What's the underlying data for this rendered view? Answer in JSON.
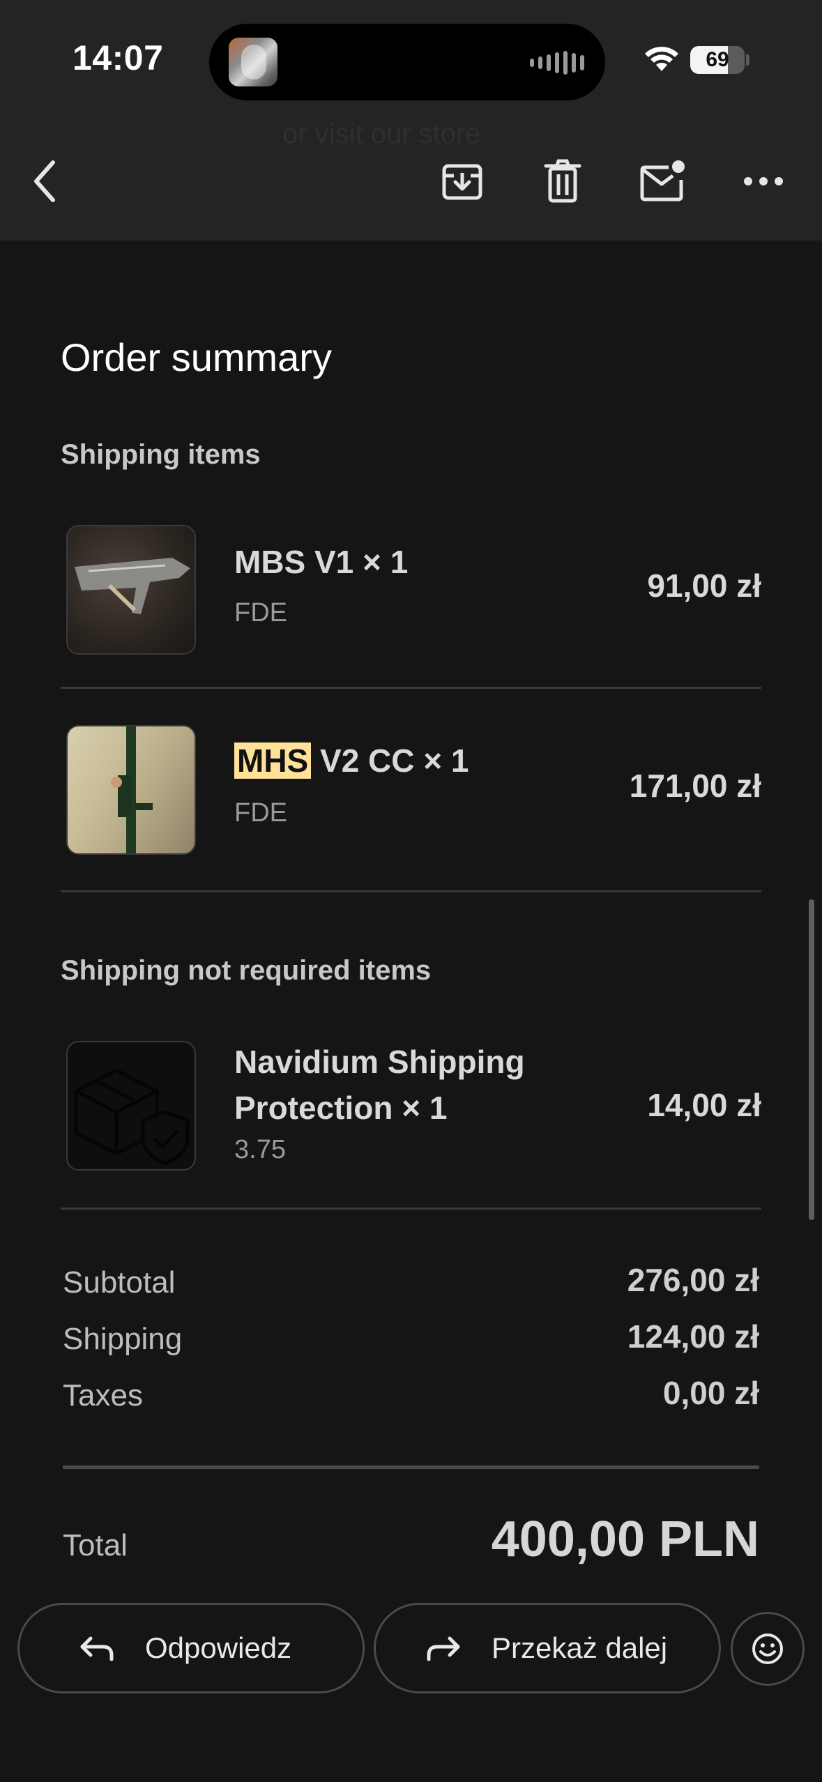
{
  "status_bar": {
    "time": "14:07",
    "battery": "69",
    "battery_level": 0.69,
    "icons": [
      "album-art-icon",
      "waveform-icon",
      "wifi-icon",
      "battery-icon"
    ]
  },
  "header": {
    "ghost_text": "or visit our store",
    "buttons": [
      "back-chevron-icon",
      "archive-icon",
      "trash-icon",
      "mark-unread-icon",
      "more-icon"
    ]
  },
  "order": {
    "title": "Order summary",
    "shipping_section": "Shipping items",
    "items": [
      {
        "name": "MBS V1 × 1",
        "name_highlight": "",
        "variant": "FDE",
        "price": "91,00 zł"
      },
      {
        "name": " V2 CC × 1",
        "name_highlight": "MHS",
        "variant": "FDE",
        "price": "171,00 zł"
      }
    ],
    "no_shipping_section": "Shipping not required items",
    "extra_item": {
      "name_line1": "Navidium Shipping",
      "name_line2": "Protection × 1",
      "variant": "3.75",
      "price": "14,00 zł"
    },
    "summary": {
      "subtotal_label": "Subtotal",
      "subtotal": "276,00 zł",
      "shipping_label": "Shipping",
      "shipping": "124,00 zł",
      "taxes_label": "Taxes",
      "taxes": "0,00 zł"
    },
    "total_label": "Total",
    "total": "400,00 PLN"
  },
  "actions": {
    "reply": "Odpowiedz",
    "forward": "Przekaż dalej",
    "emoji": "emoji-reaction-icon"
  },
  "colors": {
    "background": "#151515",
    "topbar": "#242424",
    "highlight": "#ffe19a"
  }
}
